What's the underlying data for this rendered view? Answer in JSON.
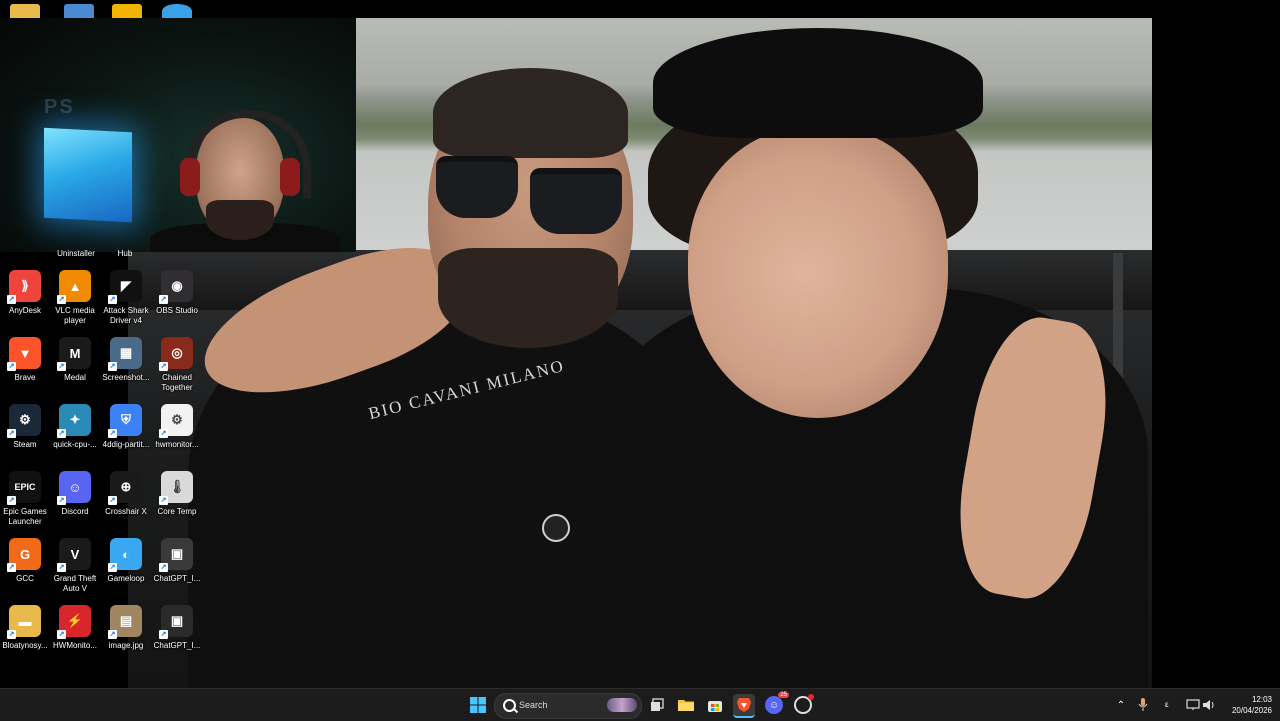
{
  "wallpaper": {
    "collar_text": "BIO CAVANI MILANO"
  },
  "webcam": {
    "overlay_text": "PS"
  },
  "cut_labels": [
    "Uninstaller",
    "Hub"
  ],
  "desktop_icons": [
    {
      "label": "AnyDesk",
      "color": "#ef443b",
      "glyph": "⟫"
    },
    {
      "label": "VLC media player",
      "color": "#f08a00",
      "glyph": "▲"
    },
    {
      "label": "Attack Shark Driver v4",
      "color": "#111111",
      "glyph": "◤"
    },
    {
      "label": "OBS Studio",
      "color": "#302e31",
      "glyph": "◉"
    },
    {
      "label": "Brave",
      "color": "#fb542b",
      "glyph": "▼"
    },
    {
      "label": "Medal",
      "color": "#1a1a1a",
      "glyph": "M"
    },
    {
      "label": "Screenshot...",
      "color": "#4a6a8a",
      "glyph": "▦"
    },
    {
      "label": "Chained Together",
      "color": "#8a2a1a",
      "glyph": "◎"
    },
    {
      "label": "Steam",
      "color": "#1b2838",
      "glyph": "⚙"
    },
    {
      "label": "quick-cpu-...",
      "color": "#2a8ab6",
      "glyph": "✦"
    },
    {
      "label": "4ddig-partit...",
      "color": "#3b82f6",
      "glyph": "⛨"
    },
    {
      "label": "hwmonitor...",
      "color": "#f2f2f2",
      "glyph": "⚙"
    },
    {
      "label": "Epic Games Launcher",
      "color": "#111111",
      "glyph": "EPIC"
    },
    {
      "label": "Discord",
      "color": "#5865f2",
      "glyph": "☺"
    },
    {
      "label": "Crosshair X",
      "color": "#1a1a1a",
      "glyph": "⊕"
    },
    {
      "label": "Core Temp",
      "color": "#d9d9d9",
      "glyph": "🌡"
    },
    {
      "label": "GCC",
      "color": "#f06a1a",
      "glyph": "G"
    },
    {
      "label": "Grand Theft Auto V",
      "color": "#1a1a1a",
      "glyph": "V"
    },
    {
      "label": "Gameloop",
      "color": "#3aa8f0",
      "glyph": "◐"
    },
    {
      "label": "ChatGPT_I...",
      "color": "#3a3a3a",
      "glyph": "▣"
    },
    {
      "label": "Bloatynosy...",
      "color": "#e8b84a",
      "glyph": "▬"
    },
    {
      "label": "HWMonito...",
      "color": "#d9262b",
      "glyph": "⚡"
    },
    {
      "label": "image.jpg",
      "color": "#a08660",
      "glyph": "▤"
    },
    {
      "label": "ChatGPT_I...",
      "color": "#2a2a2a",
      "glyph": "▣"
    }
  ],
  "taskbar": {
    "search_label": "Search",
    "chat_glyph": "☺",
    "chat_badge_count": "25",
    "ime_label": "ε",
    "time": "12:03",
    "date": "20/04/2026"
  }
}
